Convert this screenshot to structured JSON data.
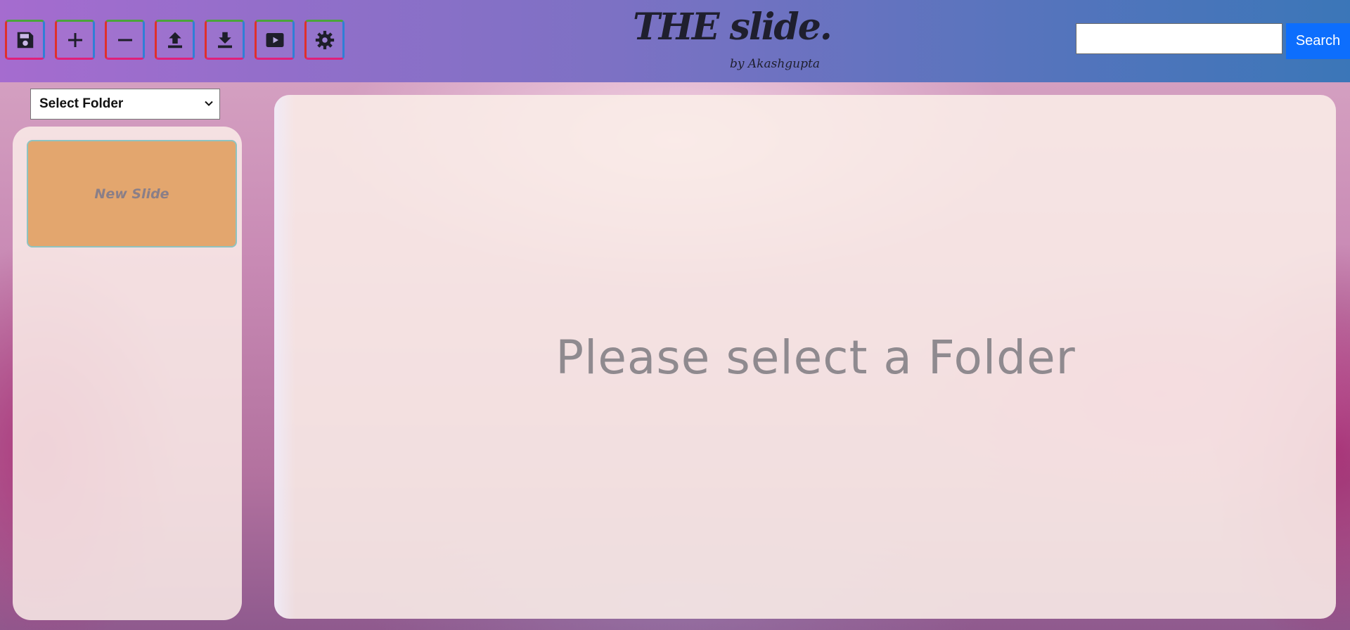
{
  "header": {
    "toolbar": [
      {
        "name": "save-button",
        "icon": "floppy-disk-icon"
      },
      {
        "name": "add-button",
        "icon": "plus-icon"
      },
      {
        "name": "remove-button",
        "icon": "minus-icon"
      },
      {
        "name": "upload-button",
        "icon": "upload-icon"
      },
      {
        "name": "download-button",
        "icon": "download-icon"
      },
      {
        "name": "present-button",
        "icon": "play-icon"
      },
      {
        "name": "settings-button",
        "icon": "gear-icon"
      }
    ],
    "brand_title": "THE slide.",
    "brand_subtitle": "by Akashgupta",
    "search": {
      "value": "",
      "button_label": "Search"
    }
  },
  "sidebar": {
    "folder_select": {
      "selected": "Select Folder"
    },
    "slides": [
      {
        "label": "New Slide"
      }
    ]
  },
  "main": {
    "message": "Please select a Folder"
  },
  "colors": {
    "search_button": "#0d6efd",
    "slide_thumb": "#e3a66e",
    "header_left": "#a56ccf",
    "header_right": "#3b76b8"
  }
}
